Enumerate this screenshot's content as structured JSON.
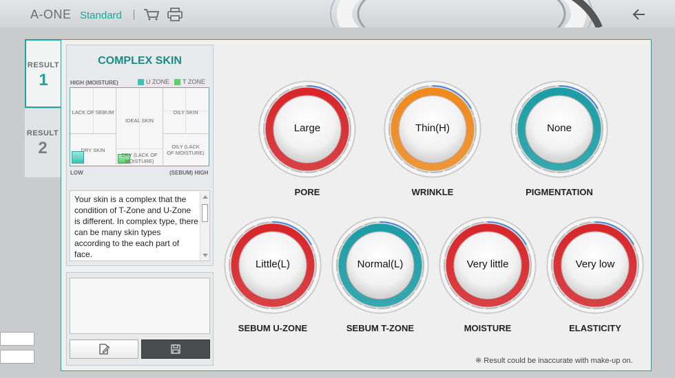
{
  "header": {
    "brand": "A-ONE",
    "brand_sub": "Standard",
    "icons": [
      "cart-icon",
      "print-icon",
      "back-arrow-icon"
    ]
  },
  "tabs": [
    {
      "label": "RESULT",
      "number": "1",
      "active": true
    },
    {
      "label": "RESULT",
      "number": "2",
      "active": false
    }
  ],
  "info": {
    "title": "COMPLEX SKIN",
    "legend_u": "U ZONE",
    "legend_t": "T ZONE",
    "axis_top": "HIGH (MOISTURE)",
    "axis_low": "LOW",
    "axis_right": "(SEBUM) HIGH",
    "cells": {
      "lack_of_sebum": "LACK OF SEBUM",
      "ideal_skin": "IDEAL  SKIN",
      "oily_skin": "OILY SKIN",
      "dry_skin": "DRY SKIN",
      "dry_lack_1": "DRY (LACK OF",
      "dry_lack_2": "MOISTURE)",
      "oily_lack_1": "OILY (LACK",
      "oily_lack_2": "OF MOISTURE)"
    },
    "description": "Your skin is a complex that the condition of T-Zone and U-Zone is different. In complex type, there can be many skin types according to the each part of face."
  },
  "colors": {
    "accent": "#1aa6a0",
    "red": "#d8262a",
    "orange": "#f08a1c",
    "teal": "#1b9ea6",
    "u_zone": "#3cc4b8",
    "t_zone": "#5ccf72"
  },
  "gauges": [
    {
      "name": "PORE",
      "value": "Large",
      "color": "red"
    },
    {
      "name": "WRINKLE",
      "value": "Thin(H)",
      "color": "orange"
    },
    {
      "name": "PIGMENTATION",
      "value": "None",
      "color": "teal"
    },
    {
      "name": "SEBUM U-ZONE",
      "value": "Little(L)",
      "color": "red"
    },
    {
      "name": "SEBUM T-ZONE",
      "value": "Normal(L)",
      "color": "teal"
    },
    {
      "name": "MOISTURE",
      "value": "Very little",
      "color": "red"
    },
    {
      "name": "ELASTICITY",
      "value": "Very low",
      "color": "red"
    }
  ],
  "disclaimer": "※ Result could be inaccurate with make-up on."
}
